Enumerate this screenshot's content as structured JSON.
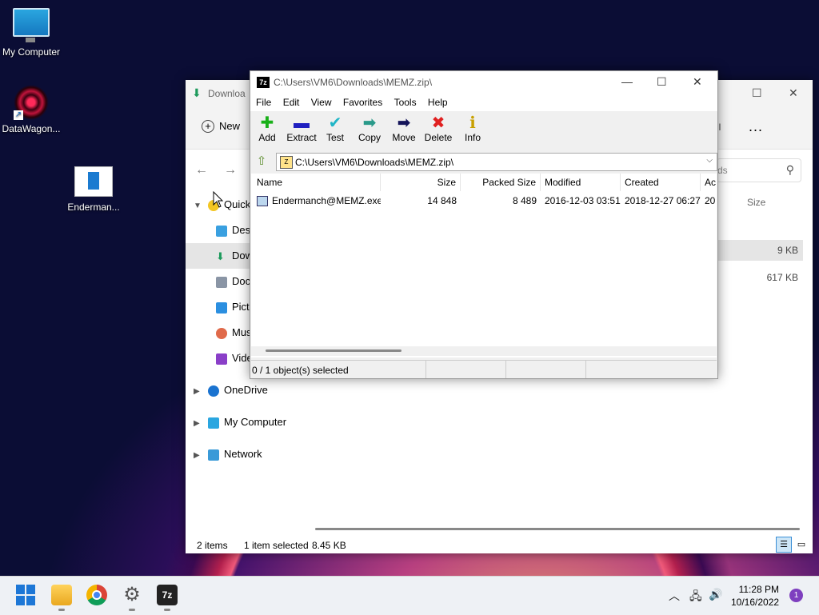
{
  "desktop": {
    "icons": [
      {
        "label": "My Computer"
      },
      {
        "label": "DataWagon..."
      },
      {
        "label": "Enderman..."
      }
    ]
  },
  "explorer": {
    "title": "Downloa",
    "new_label": "New",
    "more_label": "...",
    "trunc_label": "ll",
    "search_placeholder": "ds",
    "col_size": "Size",
    "sidebar": [
      {
        "label": "Quick"
      },
      {
        "label": "Desk"
      },
      {
        "label": "Dow"
      },
      {
        "label": "Doc"
      },
      {
        "label": "Pict"
      },
      {
        "label": "Mus"
      },
      {
        "label": "Vide"
      },
      {
        "label": "OneDrive"
      },
      {
        "label": "My Computer"
      },
      {
        "label": "Network"
      }
    ],
    "rows": [
      {
        "size": "9 KB"
      },
      {
        "size": "617 KB"
      }
    ],
    "status": {
      "items": "2 items",
      "selected": "1 item selected",
      "size": "8.45 KB"
    }
  },
  "sevenzip": {
    "title": "C:\\Users\\VM6\\Downloads\\MEMZ.zip\\",
    "menu": [
      "File",
      "Edit",
      "View",
      "Favorites",
      "Tools",
      "Help"
    ],
    "toolbar": [
      {
        "label": "Add",
        "glyph": "✚",
        "color": "#19b019"
      },
      {
        "label": "Extract",
        "glyph": "▬",
        "color": "#2020c0"
      },
      {
        "label": "Test",
        "glyph": "✔",
        "color": "#21b6c7"
      },
      {
        "label": "Copy",
        "glyph": "➡",
        "color": "#2a9a8a"
      },
      {
        "label": "Move",
        "glyph": "➡",
        "color": "#14145a"
      },
      {
        "label": "Delete",
        "glyph": "✖",
        "color": "#e02020"
      },
      {
        "label": "Info",
        "glyph": "ℹ",
        "color": "#c8a000"
      }
    ],
    "path": "C:\\Users\\VM6\\Downloads\\MEMZ.zip\\",
    "columns": [
      "Name",
      "Size",
      "Packed Size",
      "Modified",
      "Created",
      "Ac"
    ],
    "files": [
      {
        "name": "Endermanch@MEMZ.exe",
        "size": "14 848",
        "packed": "8 489",
        "modified": "2016-12-03 03:51",
        "created": "2018-12-27 06:27",
        "accessed": "20"
      }
    ],
    "status": "0 / 1 object(s) selected"
  },
  "taskbar": {
    "time": "11:28 PM",
    "date": "10/16/2022",
    "notifications": "1"
  }
}
